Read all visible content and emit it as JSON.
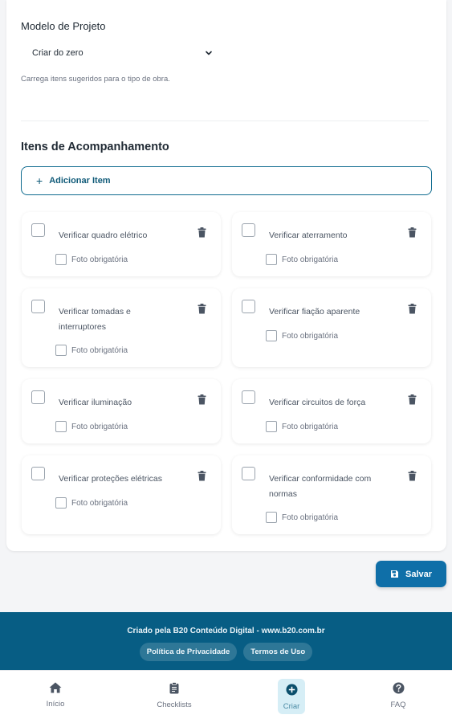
{
  "model": {
    "label": "Modelo de Projeto",
    "selected": "Criar do zero",
    "help": "Carrega itens sugeridos para o tipo de obra."
  },
  "items_section": {
    "title": "Itens de Acompanhamento",
    "add_button": "Adicionar Item",
    "photo_label": "Foto obrigatória",
    "items": [
      {
        "text": "Verificar quadro elétrico"
      },
      {
        "text": "Verificar aterramento"
      },
      {
        "text": "Verificar tomadas e interruptores"
      },
      {
        "text": "Verificar fiação aparente"
      },
      {
        "text": "Verificar iluminação"
      },
      {
        "text": "Verificar circuitos de força"
      },
      {
        "text": "Verificar proteções elétricas"
      },
      {
        "text": "Verificar conformidade com normas"
      }
    ]
  },
  "actions": {
    "save": "Salvar"
  },
  "footer": {
    "credit": "Criado pela B20 Conteúdo Digital - www.b20.com.br",
    "privacy": "Política de Privacidade",
    "terms": "Termos de Uso"
  },
  "nav": {
    "home": "Início",
    "checklists": "Checklists",
    "create": "Criar",
    "faq": "FAQ"
  },
  "colors": {
    "primary": "#0f6fa8",
    "footer_bg": "#075d84",
    "active_nav_bg": "#d6eef6"
  },
  "icons": [
    "chevron-down-icon",
    "plus-icon",
    "trash-icon",
    "save-icon",
    "home-icon",
    "clipboard-icon",
    "plus-circle-icon",
    "question-circle-icon"
  ]
}
